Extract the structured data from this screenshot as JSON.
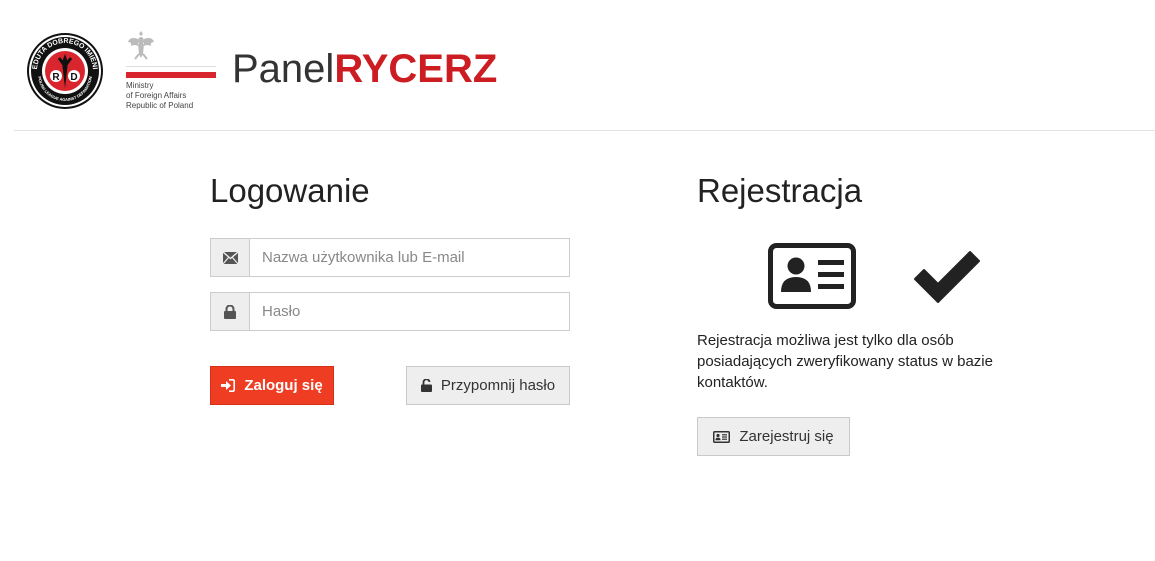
{
  "header": {
    "rdi_logo": {
      "icon": "reduta-dobrego-imienia-seal",
      "text_top": "REDUTA DOBREGO IMIENIA",
      "text_bottom": "POLISH LEAGUE AGAINST DEFAMATION",
      "letters": "R I D"
    },
    "mfa_logo": {
      "icon": "polish-eagle-icon",
      "lines": [
        "Ministry",
        "of Foreign Affairs",
        "Republic of Poland"
      ]
    },
    "brand_light": "Panel",
    "brand_bold": "RYCERZ"
  },
  "login": {
    "title": "Logowanie",
    "username_placeholder": "Nazwa użytkownika lub E-mail",
    "username_icon": "envelope-icon",
    "password_placeholder": "Hasło",
    "password_icon": "lock-icon",
    "login_button": "Zaloguj się",
    "login_button_icon": "sign-in-icon",
    "remind_button": "Przypomnij hasło",
    "remind_button_icon": "unlock-icon"
  },
  "registration": {
    "title": "Rejestracja",
    "illustration_icons": [
      "id-card-icon",
      "checkmark-icon"
    ],
    "text": "Rejestracja możliwa jest tylko dla osób posiadających zweryfikowany status w bazie kontaktów.",
    "register_button": "Zarejestruj się",
    "register_button_icon": "id-card-icon"
  },
  "colors": {
    "brand_red": "#cc1d22",
    "login_button": "#ee3d23",
    "secondary_button": "#eeeeee"
  }
}
